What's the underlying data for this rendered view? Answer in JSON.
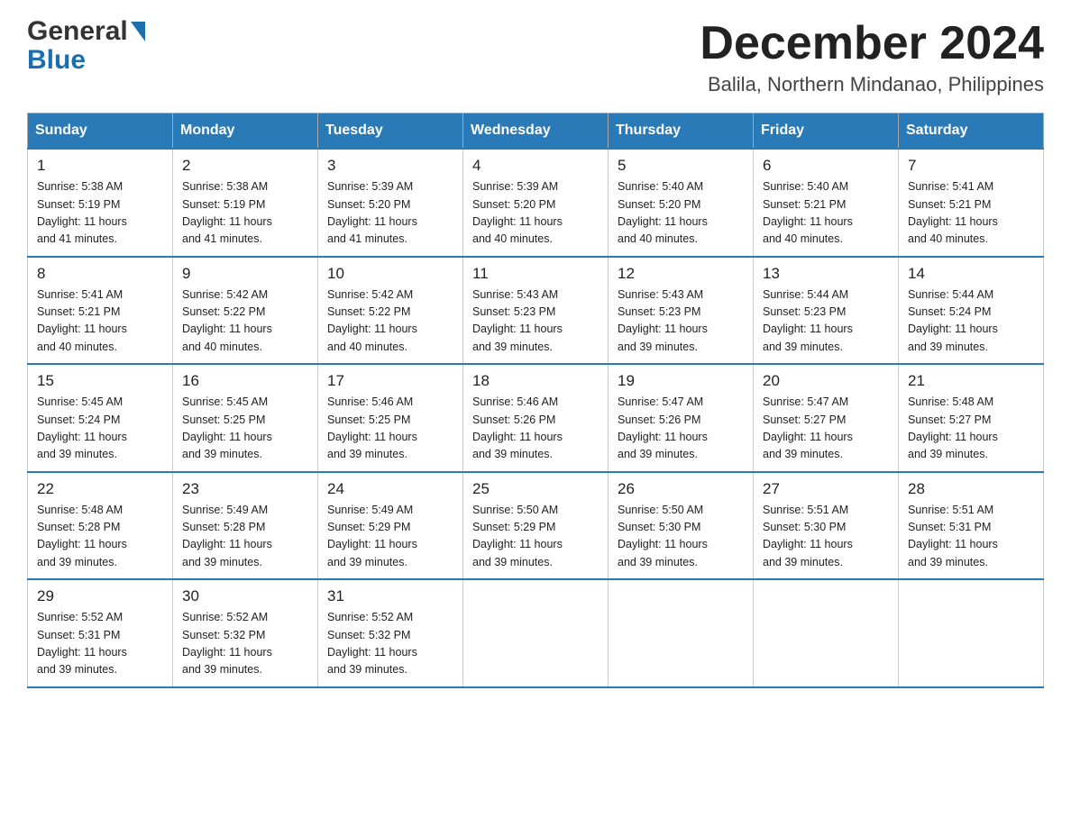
{
  "header": {
    "logo_general": "General",
    "logo_blue": "Blue",
    "month_title": "December 2024",
    "location": "Balila, Northern Mindanao, Philippines"
  },
  "days_of_week": [
    "Sunday",
    "Monday",
    "Tuesday",
    "Wednesday",
    "Thursday",
    "Friday",
    "Saturday"
  ],
  "weeks": [
    [
      {
        "day": "1",
        "sunrise": "5:38 AM",
        "sunset": "5:19 PM",
        "daylight": "11 hours and 41 minutes."
      },
      {
        "day": "2",
        "sunrise": "5:38 AM",
        "sunset": "5:19 PM",
        "daylight": "11 hours and 41 minutes."
      },
      {
        "day": "3",
        "sunrise": "5:39 AM",
        "sunset": "5:20 PM",
        "daylight": "11 hours and 41 minutes."
      },
      {
        "day": "4",
        "sunrise": "5:39 AM",
        "sunset": "5:20 PM",
        "daylight": "11 hours and 40 minutes."
      },
      {
        "day": "5",
        "sunrise": "5:40 AM",
        "sunset": "5:20 PM",
        "daylight": "11 hours and 40 minutes."
      },
      {
        "day": "6",
        "sunrise": "5:40 AM",
        "sunset": "5:21 PM",
        "daylight": "11 hours and 40 minutes."
      },
      {
        "day": "7",
        "sunrise": "5:41 AM",
        "sunset": "5:21 PM",
        "daylight": "11 hours and 40 minutes."
      }
    ],
    [
      {
        "day": "8",
        "sunrise": "5:41 AM",
        "sunset": "5:21 PM",
        "daylight": "11 hours and 40 minutes."
      },
      {
        "day": "9",
        "sunrise": "5:42 AM",
        "sunset": "5:22 PM",
        "daylight": "11 hours and 40 minutes."
      },
      {
        "day": "10",
        "sunrise": "5:42 AM",
        "sunset": "5:22 PM",
        "daylight": "11 hours and 40 minutes."
      },
      {
        "day": "11",
        "sunrise": "5:43 AM",
        "sunset": "5:23 PM",
        "daylight": "11 hours and 39 minutes."
      },
      {
        "day": "12",
        "sunrise": "5:43 AM",
        "sunset": "5:23 PM",
        "daylight": "11 hours and 39 minutes."
      },
      {
        "day": "13",
        "sunrise": "5:44 AM",
        "sunset": "5:23 PM",
        "daylight": "11 hours and 39 minutes."
      },
      {
        "day": "14",
        "sunrise": "5:44 AM",
        "sunset": "5:24 PM",
        "daylight": "11 hours and 39 minutes."
      }
    ],
    [
      {
        "day": "15",
        "sunrise": "5:45 AM",
        "sunset": "5:24 PM",
        "daylight": "11 hours and 39 minutes."
      },
      {
        "day": "16",
        "sunrise": "5:45 AM",
        "sunset": "5:25 PM",
        "daylight": "11 hours and 39 minutes."
      },
      {
        "day": "17",
        "sunrise": "5:46 AM",
        "sunset": "5:25 PM",
        "daylight": "11 hours and 39 minutes."
      },
      {
        "day": "18",
        "sunrise": "5:46 AM",
        "sunset": "5:26 PM",
        "daylight": "11 hours and 39 minutes."
      },
      {
        "day": "19",
        "sunrise": "5:47 AM",
        "sunset": "5:26 PM",
        "daylight": "11 hours and 39 minutes."
      },
      {
        "day": "20",
        "sunrise": "5:47 AM",
        "sunset": "5:27 PM",
        "daylight": "11 hours and 39 minutes."
      },
      {
        "day": "21",
        "sunrise": "5:48 AM",
        "sunset": "5:27 PM",
        "daylight": "11 hours and 39 minutes."
      }
    ],
    [
      {
        "day": "22",
        "sunrise": "5:48 AM",
        "sunset": "5:28 PM",
        "daylight": "11 hours and 39 minutes."
      },
      {
        "day": "23",
        "sunrise": "5:49 AM",
        "sunset": "5:28 PM",
        "daylight": "11 hours and 39 minutes."
      },
      {
        "day": "24",
        "sunrise": "5:49 AM",
        "sunset": "5:29 PM",
        "daylight": "11 hours and 39 minutes."
      },
      {
        "day": "25",
        "sunrise": "5:50 AM",
        "sunset": "5:29 PM",
        "daylight": "11 hours and 39 minutes."
      },
      {
        "day": "26",
        "sunrise": "5:50 AM",
        "sunset": "5:30 PM",
        "daylight": "11 hours and 39 minutes."
      },
      {
        "day": "27",
        "sunrise": "5:51 AM",
        "sunset": "5:30 PM",
        "daylight": "11 hours and 39 minutes."
      },
      {
        "day": "28",
        "sunrise": "5:51 AM",
        "sunset": "5:31 PM",
        "daylight": "11 hours and 39 minutes."
      }
    ],
    [
      {
        "day": "29",
        "sunrise": "5:52 AM",
        "sunset": "5:31 PM",
        "daylight": "11 hours and 39 minutes."
      },
      {
        "day": "30",
        "sunrise": "5:52 AM",
        "sunset": "5:32 PM",
        "daylight": "11 hours and 39 minutes."
      },
      {
        "day": "31",
        "sunrise": "5:52 AM",
        "sunset": "5:32 PM",
        "daylight": "11 hours and 39 minutes."
      },
      null,
      null,
      null,
      null
    ]
  ],
  "labels": {
    "sunrise": "Sunrise:",
    "sunset": "Sunset:",
    "daylight": "Daylight:"
  }
}
